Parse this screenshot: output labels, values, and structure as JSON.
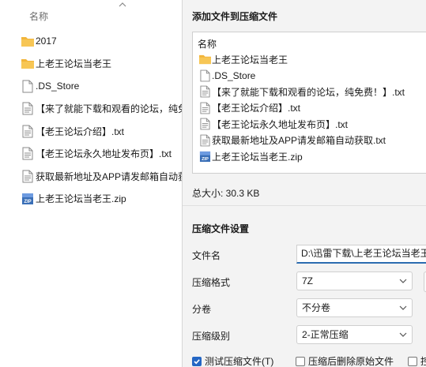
{
  "explorer": {
    "column_header": "名称",
    "items": [
      {
        "icon": "folder-icon",
        "name": "2017"
      },
      {
        "icon": "folder-icon",
        "name": "上老王论坛当老王"
      },
      {
        "icon": "file-icon",
        "name": ".DS_Store"
      },
      {
        "icon": "text-file-icon",
        "name": "【来了就能下载和观看的论坛，纯免费！】.txt"
      },
      {
        "icon": "text-file-icon",
        "name": "【老王论坛介绍】.txt"
      },
      {
        "icon": "text-file-icon",
        "name": "【老王论坛永久地址发布页】.txt"
      },
      {
        "icon": "text-file-icon",
        "name": "获取最新地址及APP请发邮箱自动获取.txt"
      },
      {
        "icon": "zip-icon",
        "name": "上老王论坛当老王.zip"
      }
    ]
  },
  "dialog": {
    "title": "添加文件到压缩文件",
    "file_list_header": "名称",
    "files": [
      {
        "icon": "folder-icon",
        "name": "上老王论坛当老王"
      },
      {
        "icon": "file-icon",
        "name": ".DS_Store"
      },
      {
        "icon": "text-file-icon",
        "name": "【来了就能下载和观看的论坛，纯免费！】.txt"
      },
      {
        "icon": "text-file-icon",
        "name": "【老王论坛介绍】.txt"
      },
      {
        "icon": "text-file-icon",
        "name": "【老王论坛永久地址发布页】.txt"
      },
      {
        "icon": "text-file-icon",
        "name": "获取最新地址及APP请发邮箱自动获取.txt"
      },
      {
        "icon": "zip-icon",
        "name": "上老王论坛当老王.zip"
      }
    ],
    "total_size": "总大小: 30.3 KB",
    "settings_title": "压缩文件设置",
    "filename_label": "文件名",
    "filename_value": "D:\\迅雷下载\\上老王论坛当老王",
    "format_label": "压缩格式",
    "format_value": "7Z",
    "split_label": "分卷",
    "split_value": "不分卷",
    "level_label": "压缩级别",
    "level_value": "2-正常压缩",
    "test_checkbox_label": "测试压缩文件(T)",
    "test_checked": true,
    "delete_checkbox_label": "压缩后删除原始文件",
    "delete_checked": false,
    "third_checkbox_label": "控",
    "third_checked": false
  },
  "colors": {
    "folder": "#f2b53a",
    "accent": "#2466c4",
    "zip": "#3a6fb7"
  }
}
